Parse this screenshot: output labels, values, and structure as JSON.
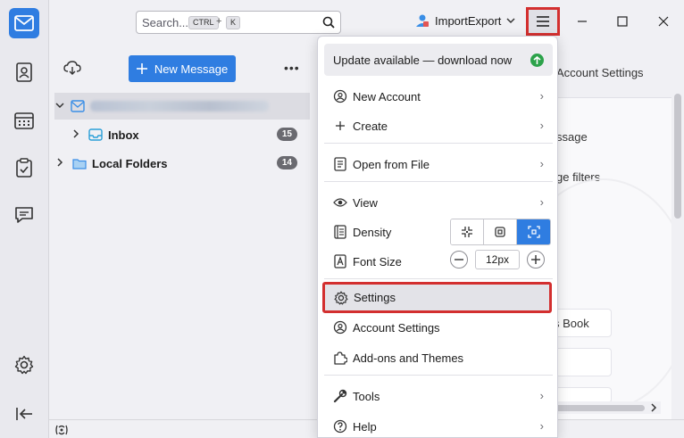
{
  "search": {
    "placeholder": "Search...",
    "shortcut_key1": "CTRL",
    "shortcut_plus": "+",
    "shortcut_key2": "K"
  },
  "account_switcher": {
    "label": "ImportExport"
  },
  "folder_pane": {
    "new_message_label": "New Message",
    "more_label": "•••",
    "folders": [
      {
        "name": "",
        "badge": ""
      },
      {
        "name": "Inbox",
        "badge": "15"
      },
      {
        "name": "Local Folders",
        "badge": "14"
      }
    ]
  },
  "content": {
    "account_settings": "Account Settings",
    "line1": "ssage",
    "line2": "ge filters",
    "card1": "s Book"
  },
  "app_menu": {
    "update_label": "Update available — download now",
    "new_account": "New Account",
    "create": "Create",
    "open_from_file": "Open from File",
    "view": "View",
    "density": "Density",
    "font_size": "Font Size",
    "font_size_value": "12px",
    "settings": "Settings",
    "account_settings": "Account Settings",
    "addons": "Add-ons and Themes",
    "tools": "Tools",
    "help": "Help"
  },
  "colors": {
    "accent": "#2f7de1",
    "highlight_border": "#d32f2f",
    "update_dot": "#2ca24a"
  }
}
